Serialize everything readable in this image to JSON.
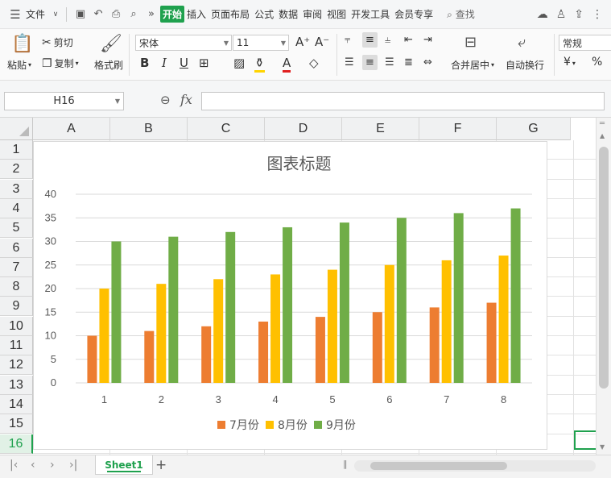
{
  "menubar": {
    "file_label": "文件",
    "tabs": [
      "开始",
      "插入",
      "页面布局",
      "公式",
      "数据",
      "审阅",
      "视图",
      "开发工具",
      "会员专享"
    ],
    "active_tab": "开始",
    "search_label": "查找"
  },
  "ribbon": {
    "paste_label": "粘贴",
    "cut_label": "剪切",
    "copy_label": "复制",
    "format_painter_label": "格式刷",
    "font_name": "宋体",
    "font_size": "11",
    "merge_label": "合并居中",
    "wrap_label": "自动换行",
    "number_format": "常规",
    "currency_symbol": "¥",
    "percent_symbol": "%"
  },
  "formula_bar": {
    "cell_ref": "H16",
    "fx": "fx",
    "formula_value": ""
  },
  "columns": [
    "A",
    "B",
    "C",
    "D",
    "E",
    "F",
    "G"
  ],
  "rows": [
    "1",
    "2",
    "3",
    "4",
    "5",
    "6",
    "7",
    "8",
    "9",
    "10",
    "11",
    "12",
    "13",
    "14",
    "15",
    "16"
  ],
  "active_row": "16",
  "sheet_tab": "Sheet1",
  "chart_data": {
    "type": "bar",
    "title": "图表标题",
    "categories": [
      "1",
      "2",
      "3",
      "4",
      "5",
      "6",
      "7",
      "8"
    ],
    "series": [
      {
        "name": "7月份",
        "color": "#ed7d31",
        "values": [
          10,
          11,
          12,
          13,
          14,
          15,
          16,
          17
        ]
      },
      {
        "name": "8月份",
        "color": "#ffc000",
        "values": [
          20,
          21,
          22,
          23,
          24,
          25,
          26,
          27
        ]
      },
      {
        "name": "9月份",
        "color": "#70ad47",
        "values": [
          30,
          31,
          32,
          33,
          34,
          35,
          36,
          37
        ]
      }
    ],
    "ylim": [
      0,
      40
    ],
    "yticks": [
      "0",
      "5",
      "10",
      "15",
      "20",
      "25",
      "30",
      "35",
      "40"
    ],
    "grid": true,
    "legend": "bottom"
  }
}
